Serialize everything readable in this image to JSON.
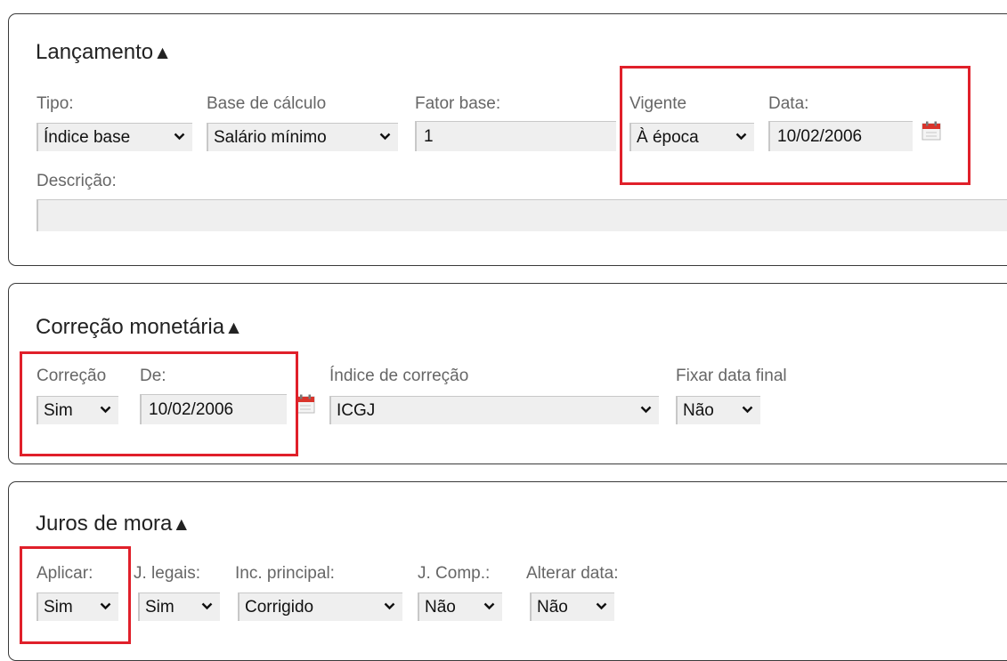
{
  "lancamento": {
    "title": "Lançamento",
    "arrow": "▲",
    "tipo_label": "Tipo:",
    "tipo_value": "Índice base",
    "base_label": "Base de cálculo",
    "base_value": "Salário mínimo",
    "fator_label": "Fator base:",
    "fator_value": "1",
    "vigente_label": "Vigente",
    "vigente_value": "À época",
    "data_label": "Data:",
    "data_value": "10/02/2006",
    "descricao_label": "Descrição:",
    "descricao_value": ""
  },
  "correcao": {
    "title": "Correção monetária",
    "arrow": "▲",
    "correcao_label": "Correção",
    "correcao_value": "Sim",
    "de_label": "De:",
    "de_value": "10/02/2006",
    "indice_label": "Índice de correção",
    "indice_value": "ICGJ",
    "fixar_label": "Fixar data final",
    "fixar_value": "Não"
  },
  "juros": {
    "title": "Juros de mora",
    "arrow": "▲",
    "aplicar_label": "Aplicar:",
    "aplicar_value": "Sim",
    "legais_label": "J. legais:",
    "legais_value": "Sim",
    "inc_label": "Inc. principal:",
    "inc_value": "Corrigido",
    "comp_label": "J. Comp.:",
    "comp_value": "Não",
    "alterar_label": "Alterar data:",
    "alterar_value": "Não"
  },
  "colors": {
    "highlight": "#e0202a",
    "field_bg": "#efefef",
    "label": "#666666",
    "panel_border": "#3a3a3a"
  },
  "icons": [
    "chevron-down-icon",
    "calendar-icon"
  ]
}
